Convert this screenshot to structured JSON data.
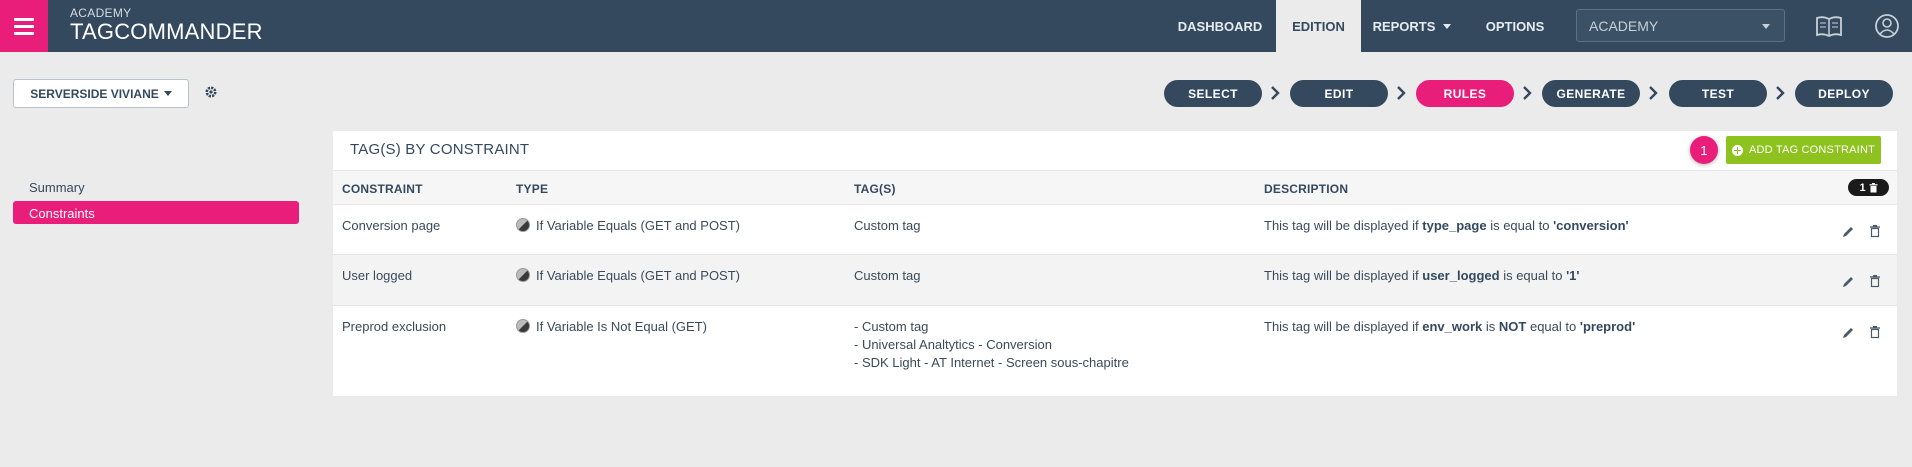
{
  "header": {
    "brand_sub": "ACADEMY",
    "brand_main": "TAGCOMMANDER",
    "nav": [
      {
        "label": "DASHBOARD"
      },
      {
        "label": "EDITION"
      },
      {
        "label": "REPORTS"
      },
      {
        "label": "OPTIONS"
      }
    ],
    "site_select": "ACADEMY",
    "icons": [
      "menu-icon",
      "book-icon",
      "user-icon"
    ]
  },
  "container_select": "SERVERSIDE VIVIANE",
  "steps": [
    {
      "label": "SELECT"
    },
    {
      "label": "EDIT"
    },
    {
      "label": "RULES"
    },
    {
      "label": "GENERATE"
    },
    {
      "label": "TEST"
    },
    {
      "label": "DEPLOY"
    }
  ],
  "sidebar": {
    "items": [
      {
        "label": "Summary"
      },
      {
        "label": "Constraints"
      }
    ]
  },
  "panel": {
    "title": "TAG(S) BY CONSTRAINT",
    "badge": "1",
    "add_button": "ADD TAG CONSTRAINT",
    "columns": {
      "constraint": "CONSTRAINT",
      "type": "TYPE",
      "tags": "TAG(S)",
      "description": "DESCRIPTION"
    },
    "count": "1",
    "rows": [
      {
        "constraint": "Conversion page",
        "type": "If Variable Equals (GET and POST)",
        "tags": [
          "Custom tag"
        ],
        "desc_pre": "This tag will be displayed if",
        "desc_var": "type_page",
        "desc_not": "",
        "desc_mid": "is equal to",
        "desc_val": "'conversion'"
      },
      {
        "constraint": "User logged",
        "type": "If Variable Equals (GET and POST)",
        "tags": [
          "Custom tag"
        ],
        "desc_pre": "This tag will be displayed if",
        "desc_var": "user_logged",
        "desc_not": "",
        "desc_mid": "is equal to",
        "desc_val": "'1'"
      },
      {
        "constraint": "Preprod exclusion",
        "type": "If Variable Is Not Equal (GET)",
        "tags": [
          "- Custom tag",
          "- Universal Analtytics - Conversion",
          "- SDK Light - AT Internet - Screen sous-chapitre"
        ],
        "desc_pre": "This tag will be displayed if",
        "desc_var": "env_work",
        "desc_is": "is",
        "desc_not": "NOT",
        "desc_mid": "equal to",
        "desc_val": "'preprod'"
      }
    ]
  },
  "colors": {
    "header_bg": "#34495e",
    "accent": "#e91e7b",
    "add_button": "#8dc21f",
    "page_bg": "#ebebeb"
  }
}
